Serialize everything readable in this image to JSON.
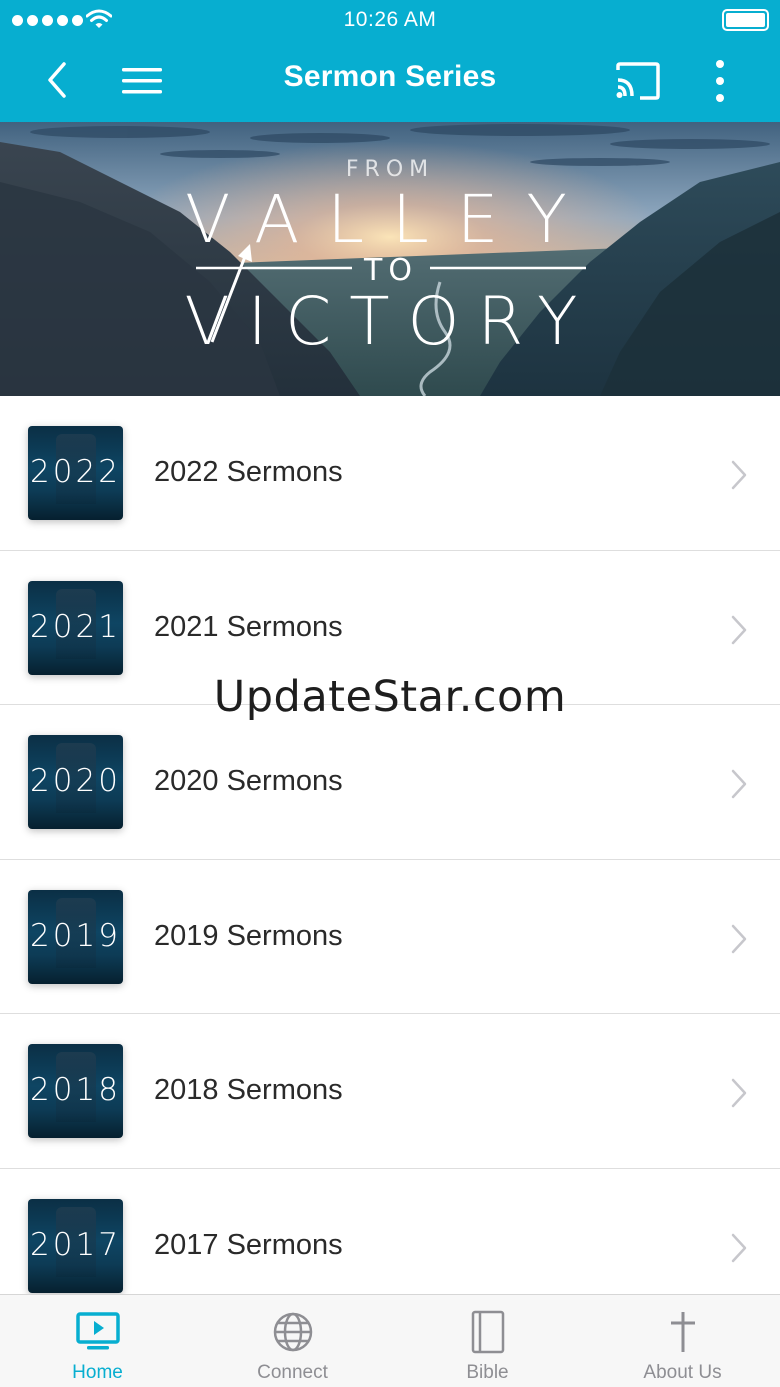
{
  "status_bar": {
    "time": "10:26 AM"
  },
  "nav": {
    "title": "Sermon Series",
    "back_icon": "chevron-left-icon",
    "menu_icon": "hamburger-menu-icon",
    "cast_icon": "cast-icon",
    "more_icon": "more-vertical-icon"
  },
  "banner": {
    "line_top": "FROM",
    "line_main1": "VALLEY",
    "line_middle": "TO",
    "line_main2": "VICTORY"
  },
  "series": [
    {
      "year": "2022",
      "label": "2022 Sermons"
    },
    {
      "year": "2021",
      "label": "2021 Sermons"
    },
    {
      "year": "2020",
      "label": "2020 Sermons"
    },
    {
      "year": "2019",
      "label": "2019 Sermons"
    },
    {
      "year": "2018",
      "label": "2018 Sermons"
    },
    {
      "year": "2017",
      "label": "2017 Sermons"
    }
  ],
  "watermark": "UpdateStar.com",
  "tabs": [
    {
      "label": "Home",
      "icon": "tv-play-icon",
      "active": true
    },
    {
      "label": "Connect",
      "icon": "globe-icon",
      "active": false
    },
    {
      "label": "Bible",
      "icon": "book-icon",
      "active": false
    },
    {
      "label": "About Us",
      "icon": "cross-icon",
      "active": false
    }
  ],
  "colors": {
    "accent": "#07aed0",
    "tab_inactive": "#8e8e93",
    "text": "#2a2a2a"
  }
}
